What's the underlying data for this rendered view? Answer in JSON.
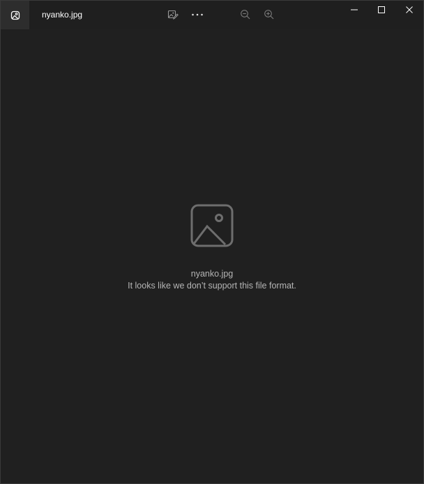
{
  "window": {
    "title": "nyanko.jpg"
  },
  "toolbar": {
    "icons": [
      "edit-image-icon",
      "more-options-icon",
      "zoom-out-icon",
      "zoom-in-icon"
    ],
    "more_label": "···"
  },
  "window_controls": {
    "icons": [
      "minimize-icon",
      "maximize-icon",
      "close-icon"
    ]
  },
  "main": {
    "icon": "image-placeholder-icon",
    "file_name": "nyanko.jpg",
    "message": "It looks like we don’t support this file format."
  },
  "colors": {
    "background": "#202020",
    "titlebar": "#1f1f1f",
    "icon_box": "#2d2d2d",
    "text_primary": "#ffffff",
    "text_secondary": "#b5b5b5",
    "placeholder_icon": "#6e6e6e"
  }
}
